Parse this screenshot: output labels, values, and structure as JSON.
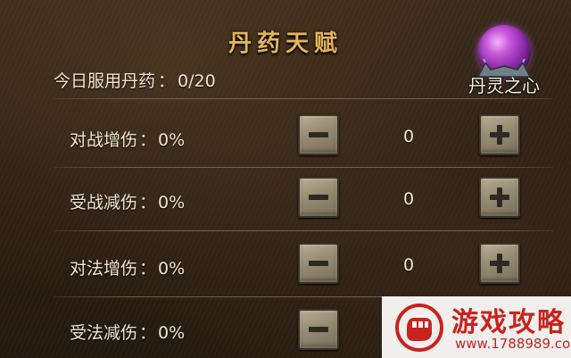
{
  "title": "丹药天赋",
  "daily": {
    "label": "今日服用丹药",
    "separator": "：",
    "value": "0/20"
  },
  "orb": {
    "label": "丹灵之心"
  },
  "rows": [
    {
      "label": "对战增伤",
      "separator": "：",
      "percent": "0%",
      "minus": true,
      "count": "0",
      "plus": true
    },
    {
      "label": "受战减伤",
      "separator": "：",
      "percent": "0%",
      "minus": true,
      "count": "0",
      "plus": true
    },
    {
      "label": "对法增伤",
      "separator": "：",
      "percent": "0%",
      "minus": true,
      "count": "0",
      "plus": true
    },
    {
      "label": "受法减伤",
      "separator": "：",
      "percent": "0%",
      "minus": true,
      "count": "",
      "plus": false
    }
  ],
  "watermark": {
    "title": "游戏攻略",
    "url": "www.1788989.com"
  },
  "colors": {
    "title": "#e3b45a",
    "text": "#f0e6d2",
    "orb": "#a637c4",
    "watermark": "#c8231e"
  },
  "icons": {
    "minus": "minus-icon",
    "plus": "plus-icon",
    "logo": "fist-logo-icon"
  }
}
